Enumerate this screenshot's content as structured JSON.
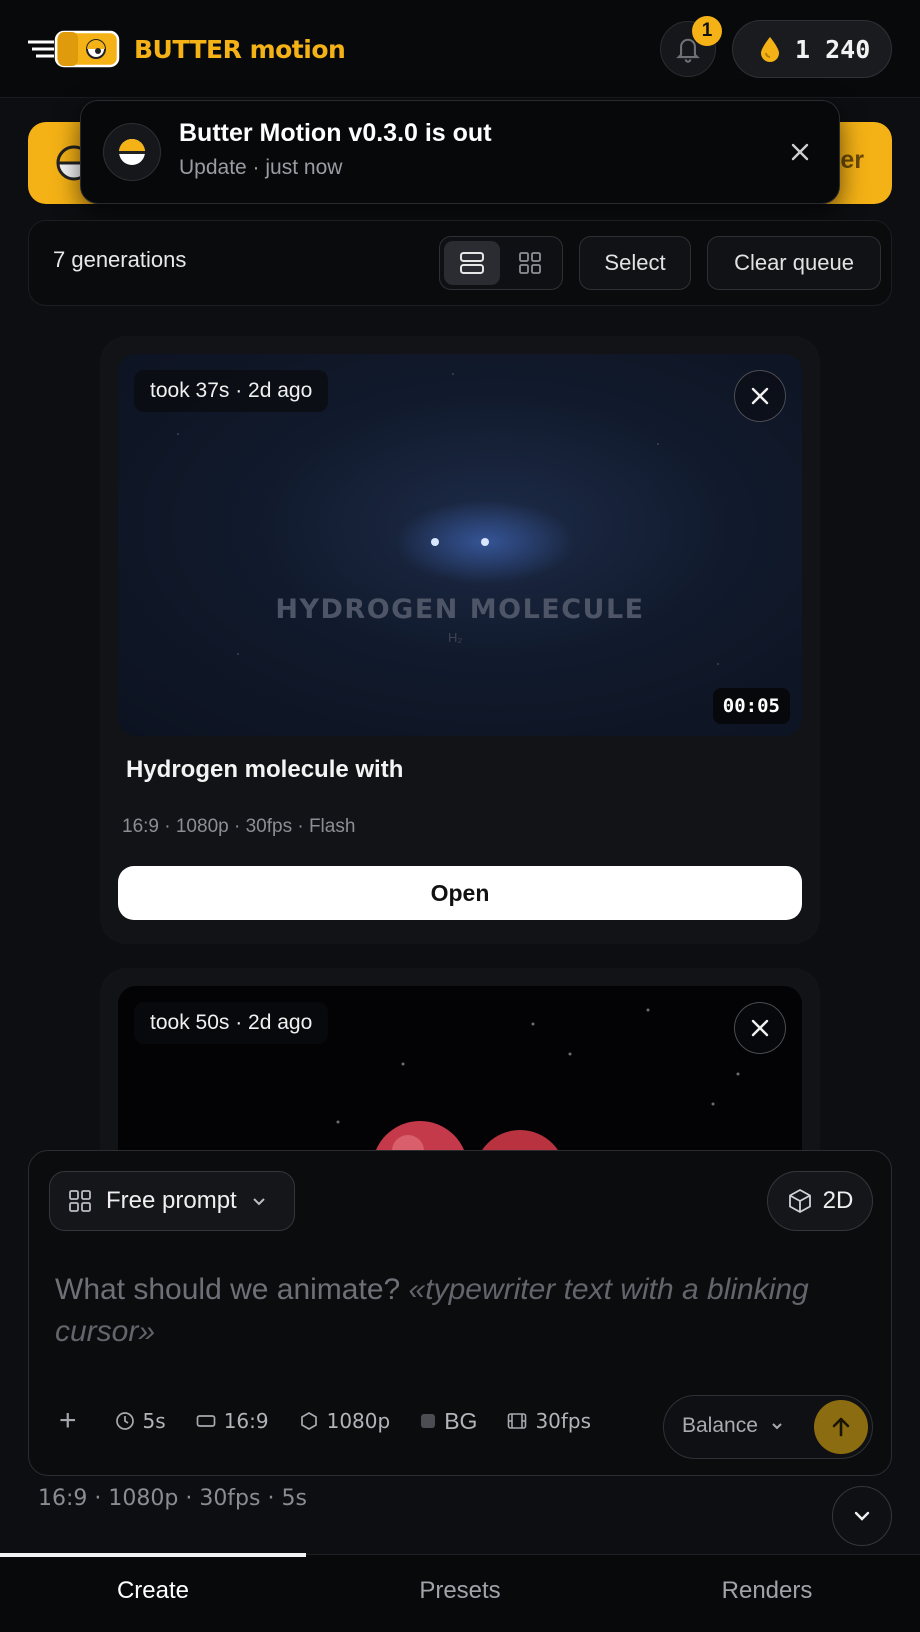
{
  "header": {
    "brand": "BUTTER motion",
    "notifications_count": "1",
    "credits": "1 240"
  },
  "banner": {
    "button_text_partial": "er"
  },
  "toast": {
    "title": "Butter Motion v0.3.0 is out",
    "subtitle": "Update · just now"
  },
  "toolbar": {
    "count_label": "7 generations",
    "select_label": "Select",
    "clear_label": "Clear queue",
    "view_mode": "list"
  },
  "cards": [
    {
      "took": "took 37s · 2d ago",
      "video_caption": "HYDROGEN MOLECULE",
      "video_subcaption": "H₂",
      "duration": "00:05",
      "title": "Hydrogen molecule with",
      "meta": "16:9 · 1080p · 30fps · Flash",
      "open_label": "Open"
    },
    {
      "took": "took 50s · 2d ago"
    }
  ],
  "composer": {
    "mode_label": "Free prompt",
    "dimension_label": "2D",
    "placeholder_lead": "What should we animate?",
    "placeholder_example": "«typewriter text with a blinking cursor»",
    "options": {
      "duration": "5s",
      "aspect": "16:9",
      "resolution": "1080p",
      "background": "BG",
      "fps": "30fps"
    },
    "quality_label": "Balance"
  },
  "summary": "16:9 · 1080p · 30fps · 5s",
  "nav": {
    "create": "Create",
    "presets": "Presets",
    "renders": "Renders",
    "active": "create"
  },
  "colors": {
    "accent": "#f5b216",
    "background": "#0d0e11",
    "card": "#121317",
    "send_button": "#8c6c10"
  }
}
